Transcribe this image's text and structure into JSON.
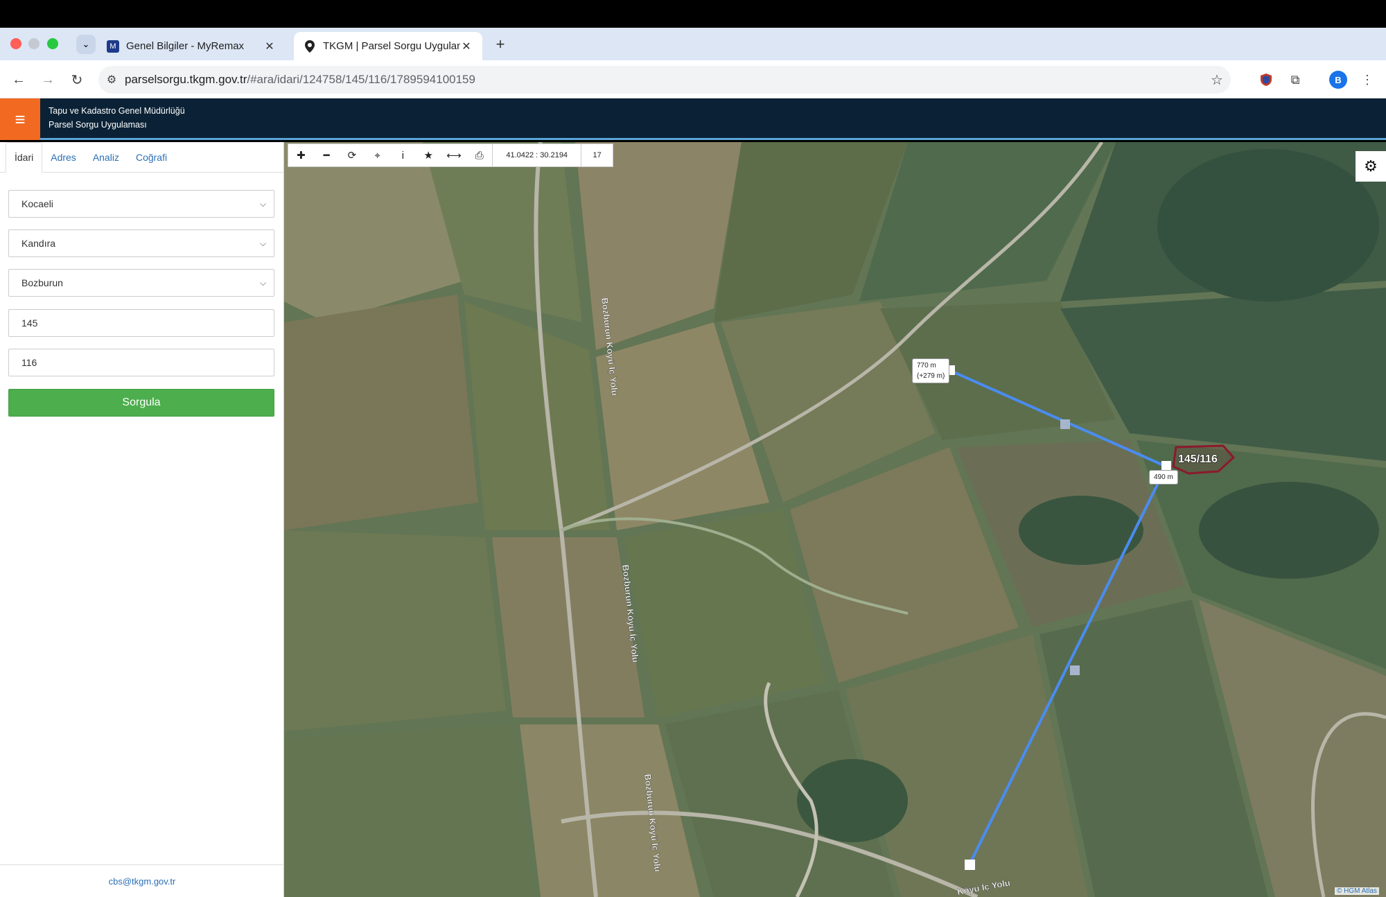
{
  "browser": {
    "tabs": [
      {
        "label": "Genel Bilgiler - MyRemax",
        "icon": "remax-icon"
      },
      {
        "label": "TKGM | Parsel Sorgu Uygulam",
        "icon": "map-pin-icon"
      }
    ],
    "url_host": "parselsorgu.tkgm.gov.tr",
    "url_path": "/#ara/idari/124758/145/116/1789594100159",
    "profile_initial": "B"
  },
  "app": {
    "title_line1": "Tapu ve Kadastro Genel Müdürlüğü",
    "title_line2": "Parsel Sorgu Uygulaması"
  },
  "sidebar": {
    "tabs": [
      "İdari",
      "Adres",
      "Analiz",
      "Coğrafi"
    ],
    "il": "Kocaeli",
    "ilce": "Kandıra",
    "mahalle": "Bozburun",
    "ada": "145",
    "parsel": "116",
    "query_button": "Sorgula",
    "footer_email": "cbs@tkgm.gov.tr"
  },
  "map": {
    "coordinates": "41.0422 : 30.2194",
    "zoom": "17",
    "parcel_label": "145/116",
    "measure_total_line1": "770 m",
    "measure_total_line2": "(+279 m)",
    "measure_segment": "490 m",
    "road_labels": [
      "Bozburun Köyü İç Yolu",
      "Bozburun Köyü İç Yolu",
      "Bozburun Köyü İç Yolu",
      "Köyü İç Yolu"
    ],
    "attribution": "© HGM Atlas",
    "colors": {
      "measure_line": "#4a8cf0",
      "parcel_outline": "#8b1a2b",
      "road": "#b8b6a8"
    }
  }
}
